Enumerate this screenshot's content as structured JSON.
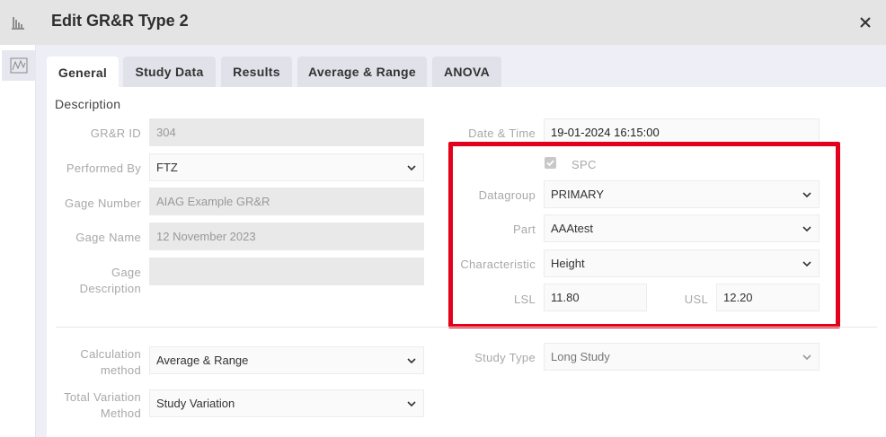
{
  "header": {
    "title": "Edit GR&R Type 2"
  },
  "sidebar": {
    "items": [
      {
        "icon": "bar-chart-icon"
      },
      {
        "icon": "line-chart-icon"
      }
    ]
  },
  "tabs": [
    {
      "label": "General",
      "active": true
    },
    {
      "label": "Study Data",
      "active": false
    },
    {
      "label": "Results",
      "active": false
    },
    {
      "label": "Average & Range",
      "active": false
    },
    {
      "label": "ANOVA",
      "active": false
    }
  ],
  "description": {
    "section_title": "Description",
    "grr_id": {
      "label": "GR&R ID",
      "value": "304"
    },
    "performed_by": {
      "label": "Performed By",
      "value": "FTZ"
    },
    "gage_number": {
      "label": "Gage Number",
      "value": "AIAG Example GR&R"
    },
    "gage_name": {
      "label": "Gage Name",
      "value": "12 November 2023"
    },
    "gage_description": {
      "label": "Gage Description",
      "value": ""
    },
    "date_time": {
      "label": "Date & Time",
      "value": "19-01-2024 16:15:00"
    },
    "spc": {
      "label": "SPC",
      "checked": true
    },
    "datagroup": {
      "label": "Datagroup",
      "value": "PRIMARY"
    },
    "part": {
      "label": "Part",
      "value": "AAAtest"
    },
    "characteristic": {
      "label": "Characteristic",
      "value": "Height"
    },
    "lsl": {
      "label": "LSL",
      "value": "11.80"
    },
    "usl": {
      "label": "USL",
      "value": "12.20"
    }
  },
  "calculation": {
    "calc_method": {
      "label_line1": "Calculation",
      "label_line2": "method",
      "value": "Average & Range"
    },
    "total_variation": {
      "label_line1": "Total Variation",
      "label_line2": "Method",
      "value": "Study Variation"
    },
    "study_type": {
      "label": "Study Type",
      "value": "Long Study"
    }
  },
  "colors": {
    "highlight": "#e3001b",
    "header_bg": "#e4e4e4",
    "tab_bg": "#e1e1e9"
  }
}
